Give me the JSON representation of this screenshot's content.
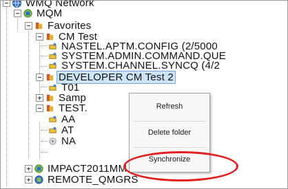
{
  "tree": {
    "nodes": [
      {
        "label": "WMQ Network",
        "icon": "globe-network-icon",
        "expander": "minus"
      },
      {
        "label": "MQM",
        "icon": "queue-manager-icon",
        "expander": "minus"
      },
      {
        "label": "Favorites",
        "icon": "favorites-folder-icon",
        "expander": "minus"
      },
      {
        "label": "CM Test",
        "icon": "favorites-folder-icon",
        "expander": "minus"
      },
      {
        "label": "NASTEL.APTM.CONFIG (2/5000",
        "icon": "queue-object-icon",
        "expander": "none"
      },
      {
        "label": "SYSTEM.ADMIN.COMMAND.QUE",
        "icon": "queue-object-icon",
        "expander": "none"
      },
      {
        "label": "SYSTEM.CHANNEL.SYNCQ (4/2",
        "icon": "queue-object-icon",
        "expander": "none"
      },
      {
        "label": "DEVELOPER CM Test 2",
        "icon": "favorites-folder-icon",
        "expander": "minus",
        "selected": true
      },
      {
        "label": "T01",
        "icon": "queue-object-icon",
        "expander": "none"
      },
      {
        "label": "Samp",
        "icon": "favorites-folder-icon",
        "expander": "plus"
      },
      {
        "label": "TEST.",
        "icon": "favorites-folder-icon",
        "expander": "minus"
      },
      {
        "label": "AA",
        "icon": "queue-object-icon",
        "expander": "none"
      },
      {
        "label": "AT",
        "icon": "queue-object-icon",
        "expander": "none"
      },
      {
        "label": "NA",
        "icon": "channel-object-icon",
        "expander": "none"
      },
      {
        "label": "IMPACT2011MM",
        "icon": "queue-manager-icon",
        "expander": "plus"
      },
      {
        "label": "REMOTE_QMGRS",
        "icon": "queue-manager-icon",
        "expander": "plus"
      }
    ]
  },
  "context_menu": {
    "items": [
      {
        "label": "Refresh"
      },
      {
        "label": "Delete folder"
      },
      {
        "label": "Synchronize"
      }
    ]
  },
  "colors": {
    "selection": "#cce4f7",
    "annotation": "#e02020",
    "menu_background": "#f7f7f7"
  }
}
